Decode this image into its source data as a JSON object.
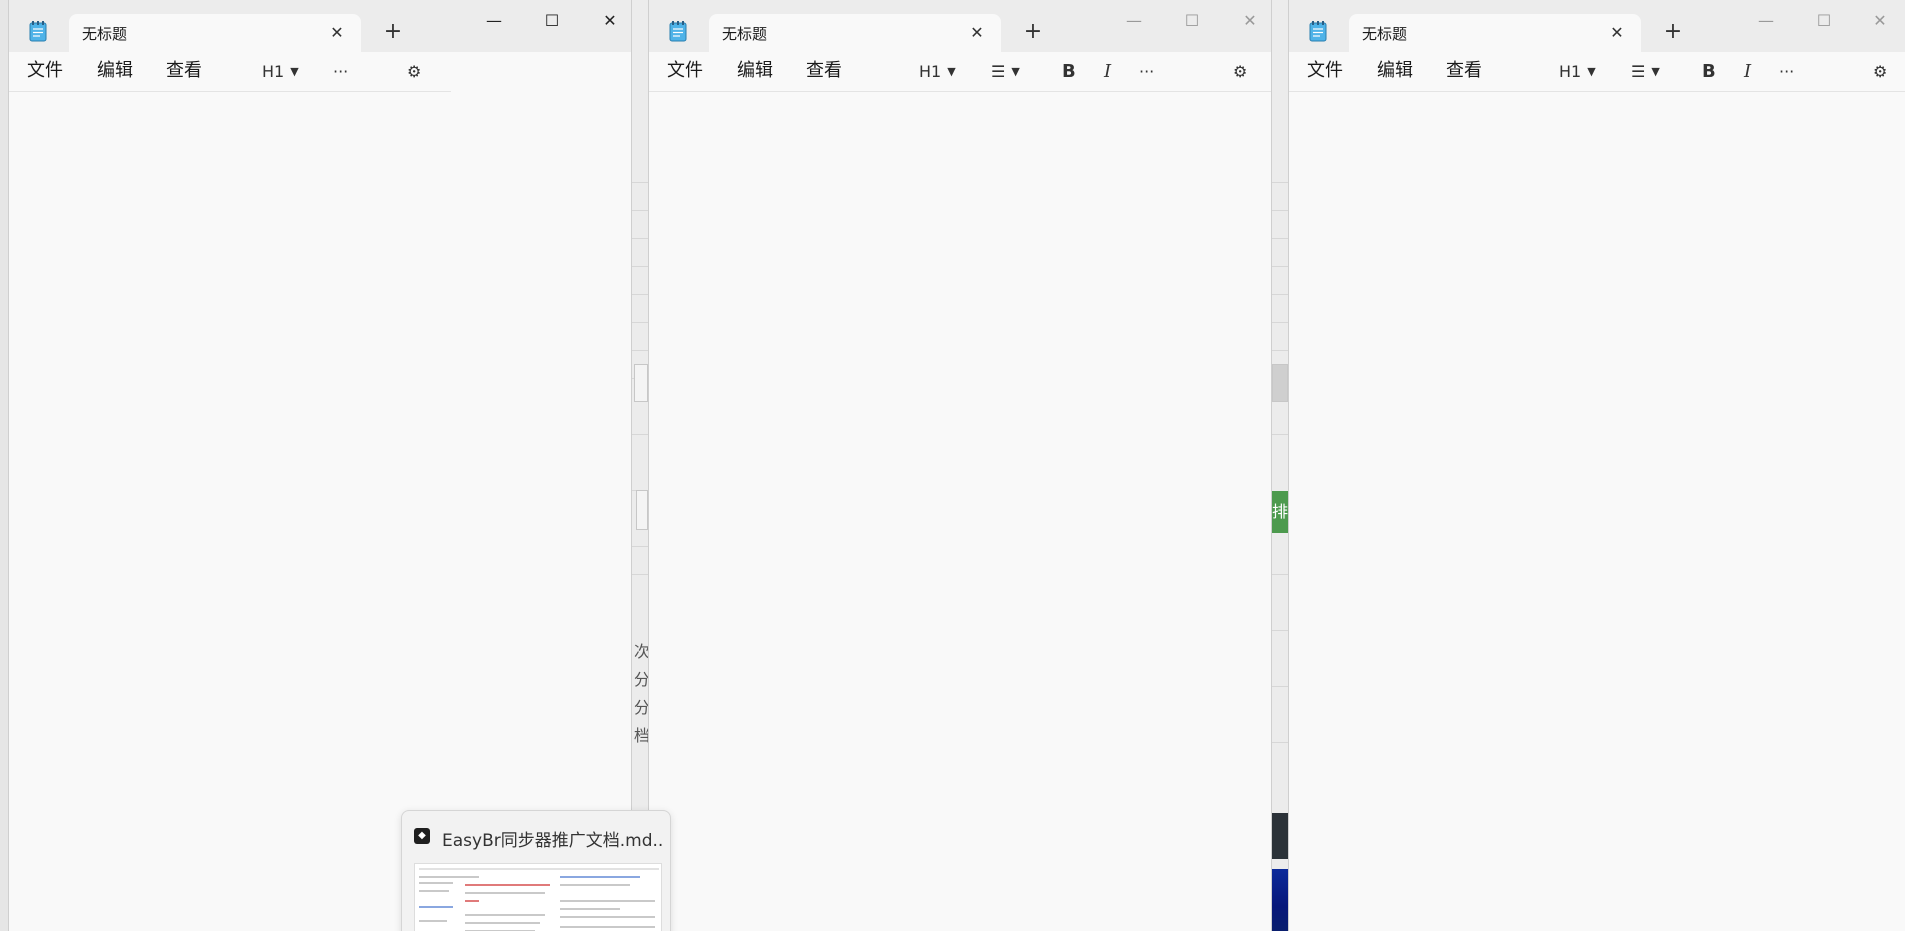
{
  "windows": [
    {
      "tab_title": "无标题",
      "menu": [
        "文件",
        "编辑",
        "查看"
      ],
      "heading_tool": "H1",
      "more_label": "···"
    },
    {
      "tab_title": "无标题",
      "menu": [
        "文件",
        "编辑",
        "查看"
      ],
      "heading_tool": "H1",
      "bold_label": "B",
      "italic_label": "I",
      "more_label": "···"
    },
    {
      "tab_title": "无标题",
      "menu": [
        "文件",
        "编辑",
        "查看"
      ],
      "heading_tool": "H1",
      "bold_label": "B",
      "italic_label": "I",
      "more_label": "···"
    }
  ],
  "background_fragments": {
    "green_button_text": "排",
    "side_texts": [
      "次",
      "分",
      "分",
      "档"
    ]
  },
  "thumbnail": {
    "title": "EasyBr同步器推广文档.md..."
  },
  "icons": {
    "app": "notepad-icon",
    "close": "close-icon",
    "new_tab": "plus-icon",
    "minimize": "minimize-icon",
    "maximize": "maximize-icon",
    "settings": "gear-icon",
    "list": "bulleted-list-icon"
  }
}
